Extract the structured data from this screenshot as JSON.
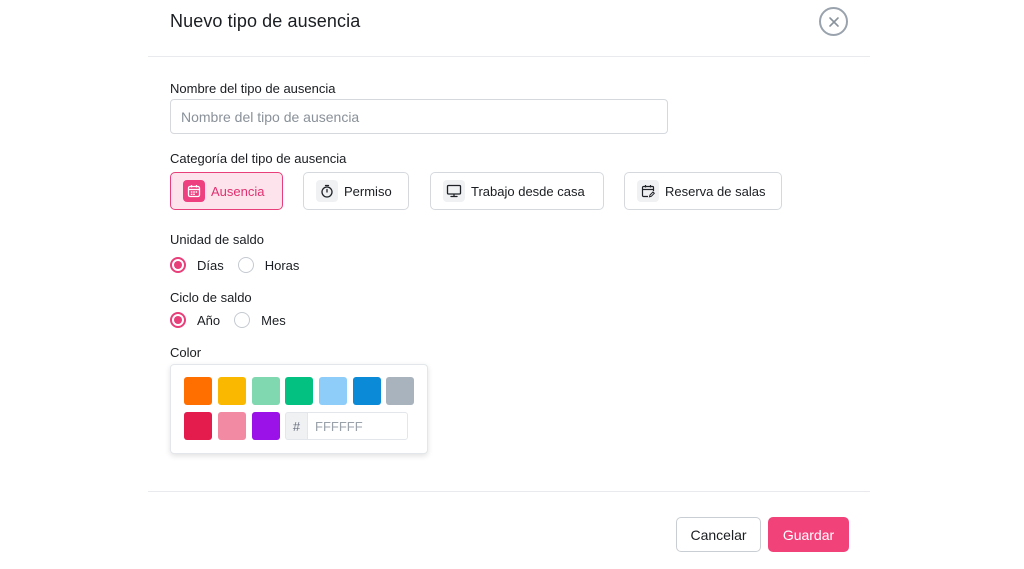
{
  "modal": {
    "title": "Nuevo tipo de ausencia",
    "close_icon": "close-icon"
  },
  "name_field": {
    "label": "Nombre del tipo de ausencia",
    "value": "",
    "placeholder": "Nombre del tipo de ausencia"
  },
  "category": {
    "label": "Categoría del tipo de ausencia",
    "options": [
      {
        "label": "Ausencia",
        "icon": "calendar-icon",
        "selected": true
      },
      {
        "label": "Permiso",
        "icon": "stopwatch-icon",
        "selected": false
      },
      {
        "label": "Trabajo desde casa",
        "icon": "monitor-icon",
        "selected": false
      },
      {
        "label": "Reserva de salas",
        "icon": "calendar-edit-icon",
        "selected": false
      }
    ]
  },
  "balance_unit": {
    "label": "Unidad de saldo",
    "options": [
      {
        "label": "Días",
        "checked": true
      },
      {
        "label": "Horas",
        "checked": false
      }
    ]
  },
  "balance_cycle": {
    "label": "Ciclo de saldo",
    "options": [
      {
        "label": "Año",
        "checked": true
      },
      {
        "label": "Mes",
        "checked": false
      }
    ]
  },
  "color": {
    "label": "Color",
    "swatches": [
      "#ff6f00",
      "#fbb800",
      "#7fd8b0",
      "#03c281",
      "#8ecdf9",
      "#0b8ad8",
      "#a8b3bd",
      "#e41c4e",
      "#f28aa3",
      "#9b12e8"
    ],
    "hex_prefix": "#",
    "hex_value": "",
    "hex_placeholder": "FFFFFF"
  },
  "footer": {
    "cancel_label": "Cancelar",
    "save_label": "Guardar"
  },
  "colors": {
    "accent": "#f2427a",
    "accent_light": "#fde4ec"
  }
}
